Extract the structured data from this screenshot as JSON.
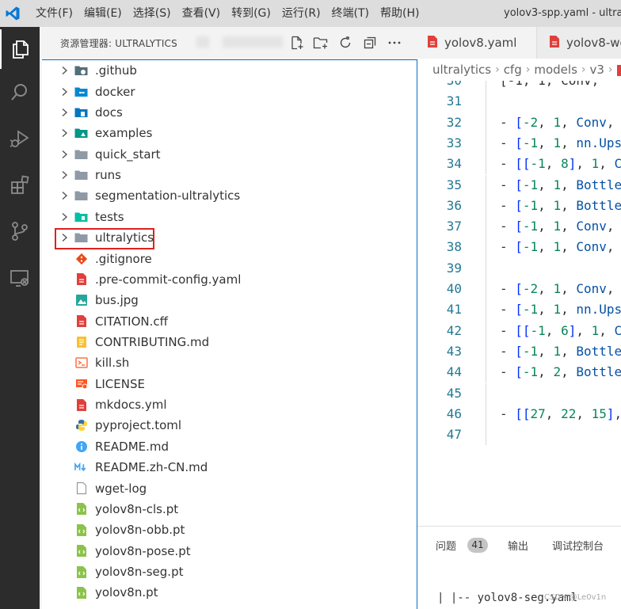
{
  "menu": {
    "items": [
      "文件(F)",
      "编辑(E)",
      "选择(S)",
      "查看(V)",
      "转到(G)",
      "运行(R)",
      "终端(T)",
      "帮助(H)"
    ],
    "window_title": "yolov3-spp.yaml - ultra"
  },
  "sidebar": {
    "title": "资源管理器: ULTRALYTICS",
    "items": [
      {
        "label": ".github",
        "type": "folder",
        "icon": "folder-github-icon"
      },
      {
        "label": "docker",
        "type": "folder",
        "icon": "folder-docker-icon"
      },
      {
        "label": "docs",
        "type": "folder",
        "icon": "folder-docs-icon"
      },
      {
        "label": "examples",
        "type": "folder",
        "icon": "folder-examples-icon"
      },
      {
        "label": "quick_start",
        "type": "folder",
        "icon": "folder-icon"
      },
      {
        "label": "runs",
        "type": "folder",
        "icon": "folder-icon"
      },
      {
        "label": "segmentation-ultralytics",
        "type": "folder",
        "icon": "folder-icon"
      },
      {
        "label": "tests",
        "type": "folder",
        "icon": "folder-tests-icon"
      },
      {
        "label": "ultralytics",
        "type": "folder",
        "icon": "folder-icon",
        "highlighted": true
      },
      {
        "label": ".gitignore",
        "type": "file",
        "icon": "git-icon"
      },
      {
        "label": ".pre-commit-config.yaml",
        "type": "file",
        "icon": "yaml-icon"
      },
      {
        "label": "bus.jpg",
        "type": "file",
        "icon": "image-icon"
      },
      {
        "label": "CITATION.cff",
        "type": "file",
        "icon": "cff-icon"
      },
      {
        "label": "CONTRIBUTING.md",
        "type": "file",
        "icon": "contributing-icon"
      },
      {
        "label": "kill.sh",
        "type": "file",
        "icon": "shell-icon"
      },
      {
        "label": "LICENSE",
        "type": "file",
        "icon": "license-icon"
      },
      {
        "label": "mkdocs.yml",
        "type": "file",
        "icon": "yaml-icon"
      },
      {
        "label": "pyproject.toml",
        "type": "file",
        "icon": "python-icon"
      },
      {
        "label": "README.md",
        "type": "file",
        "icon": "info-icon"
      },
      {
        "label": "README.zh-CN.md",
        "type": "file",
        "icon": "markdown-icon"
      },
      {
        "label": "wget-log",
        "type": "file",
        "icon": "file-icon"
      },
      {
        "label": "yolov8n-cls.pt",
        "type": "file",
        "icon": "pt-file-icon"
      },
      {
        "label": "yolov8n-obb.pt",
        "type": "file",
        "icon": "pt-file-icon"
      },
      {
        "label": "yolov8n-pose.pt",
        "type": "file",
        "icon": "pt-file-icon"
      },
      {
        "label": "yolov8n-seg.pt",
        "type": "file",
        "icon": "pt-file-icon"
      },
      {
        "label": "yolov8n.pt",
        "type": "file",
        "icon": "pt-file-icon"
      }
    ]
  },
  "tabs": [
    {
      "label": "yolov8.yaml"
    },
    {
      "label": "yolov8-wo"
    }
  ],
  "breadcrumb": [
    "ultralytics",
    "cfg",
    "models",
    "v3"
  ],
  "editor": {
    "lines": [
      {
        "n": "30",
        "tokens": [
          [
            "pun",
            "  [-1, 1, Conv,"
          ]
        ]
      },
      {
        "n": "31",
        "tokens": []
      },
      {
        "n": "32",
        "tokens": [
          [
            "dash",
            "- "
          ],
          [
            "br",
            "["
          ],
          [
            "num",
            "-2"
          ],
          [
            "pun",
            ", "
          ],
          [
            "num",
            "1"
          ],
          [
            "pun",
            ", "
          ],
          [
            "txt",
            "Conv"
          ],
          [
            "pun",
            ","
          ]
        ]
      },
      {
        "n": "33",
        "tokens": [
          [
            "dash",
            "- "
          ],
          [
            "br",
            "["
          ],
          [
            "num",
            "-1"
          ],
          [
            "pun",
            ", "
          ],
          [
            "num",
            "1"
          ],
          [
            "pun",
            ", "
          ],
          [
            "txt",
            "nn.Ups"
          ]
        ]
      },
      {
        "n": "34",
        "tokens": [
          [
            "dash",
            "- "
          ],
          [
            "br",
            "[["
          ],
          [
            "num",
            "-1"
          ],
          [
            "pun",
            ", "
          ],
          [
            "num",
            "8"
          ],
          [
            "br",
            "]"
          ],
          [
            "pun",
            ", "
          ],
          [
            "num",
            "1"
          ],
          [
            "pun",
            ", "
          ],
          [
            "txt",
            "C"
          ]
        ]
      },
      {
        "n": "35",
        "tokens": [
          [
            "dash",
            "- "
          ],
          [
            "br",
            "["
          ],
          [
            "num",
            "-1"
          ],
          [
            "pun",
            ", "
          ],
          [
            "num",
            "1"
          ],
          [
            "pun",
            ", "
          ],
          [
            "txt",
            "Bottle"
          ]
        ]
      },
      {
        "n": "36",
        "tokens": [
          [
            "dash",
            "- "
          ],
          [
            "br",
            "["
          ],
          [
            "num",
            "-1"
          ],
          [
            "pun",
            ", "
          ],
          [
            "num",
            "1"
          ],
          [
            "pun",
            ", "
          ],
          [
            "txt",
            "Bottle"
          ]
        ]
      },
      {
        "n": "37",
        "tokens": [
          [
            "dash",
            "- "
          ],
          [
            "br",
            "["
          ],
          [
            "num",
            "-1"
          ],
          [
            "pun",
            ", "
          ],
          [
            "num",
            "1"
          ],
          [
            "pun",
            ", "
          ],
          [
            "txt",
            "Conv"
          ],
          [
            "pun",
            ","
          ]
        ]
      },
      {
        "n": "38",
        "tokens": [
          [
            "dash",
            "- "
          ],
          [
            "br",
            "["
          ],
          [
            "num",
            "-1"
          ],
          [
            "pun",
            ", "
          ],
          [
            "num",
            "1"
          ],
          [
            "pun",
            ", "
          ],
          [
            "txt",
            "Conv"
          ],
          [
            "pun",
            ","
          ]
        ]
      },
      {
        "n": "39",
        "tokens": []
      },
      {
        "n": "40",
        "tokens": [
          [
            "dash",
            "- "
          ],
          [
            "br",
            "["
          ],
          [
            "num",
            "-2"
          ],
          [
            "pun",
            ", "
          ],
          [
            "num",
            "1"
          ],
          [
            "pun",
            ", "
          ],
          [
            "txt",
            "Conv"
          ],
          [
            "pun",
            ","
          ]
        ]
      },
      {
        "n": "41",
        "tokens": [
          [
            "dash",
            "- "
          ],
          [
            "br",
            "["
          ],
          [
            "num",
            "-1"
          ],
          [
            "pun",
            ", "
          ],
          [
            "num",
            "1"
          ],
          [
            "pun",
            ", "
          ],
          [
            "txt",
            "nn.Ups"
          ]
        ]
      },
      {
        "n": "42",
        "tokens": [
          [
            "dash",
            "- "
          ],
          [
            "br",
            "[["
          ],
          [
            "num",
            "-1"
          ],
          [
            "pun",
            ", "
          ],
          [
            "num",
            "6"
          ],
          [
            "br",
            "]"
          ],
          [
            "pun",
            ", "
          ],
          [
            "num",
            "1"
          ],
          [
            "pun",
            ", "
          ],
          [
            "txt",
            "C"
          ]
        ]
      },
      {
        "n": "43",
        "tokens": [
          [
            "dash",
            "- "
          ],
          [
            "br",
            "["
          ],
          [
            "num",
            "-1"
          ],
          [
            "pun",
            ", "
          ],
          [
            "num",
            "1"
          ],
          [
            "pun",
            ", "
          ],
          [
            "txt",
            "Bottle"
          ]
        ]
      },
      {
        "n": "44",
        "tokens": [
          [
            "dash",
            "- "
          ],
          [
            "br",
            "["
          ],
          [
            "num",
            "-1"
          ],
          [
            "pun",
            ", "
          ],
          [
            "num",
            "2"
          ],
          [
            "pun",
            ", "
          ],
          [
            "txt",
            "Bottle"
          ]
        ]
      },
      {
        "n": "45",
        "tokens": []
      },
      {
        "n": "46",
        "tokens": [
          [
            "dash",
            "- "
          ],
          [
            "br",
            "[["
          ],
          [
            "num",
            "27"
          ],
          [
            "pun",
            ", "
          ],
          [
            "num",
            "22"
          ],
          [
            "pun",
            ", "
          ],
          [
            "num",
            "15"
          ],
          [
            "br",
            "]"
          ],
          [
            "pun",
            ","
          ]
        ]
      },
      {
        "n": "47",
        "tokens": []
      }
    ]
  },
  "panel": {
    "tabs": [
      "问题",
      "输出",
      "调试控制台"
    ],
    "problems_count": "41",
    "terminal_line": "|   |-- yolov8-seg.yaml",
    "watermark": "CSDN @Le0v1n"
  },
  "colors": {
    "accent": "#0a6cc2",
    "highlight": "#e02020",
    "activity_bar": "#2c2c2c"
  }
}
